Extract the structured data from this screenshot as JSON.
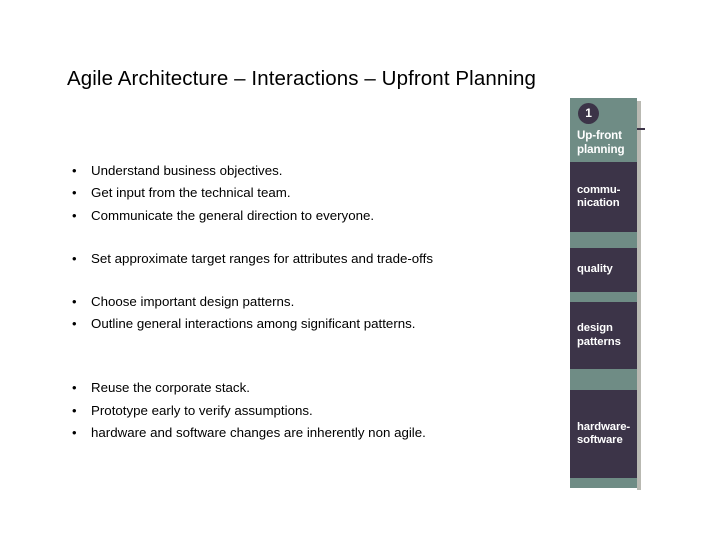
{
  "slide": {
    "title": "Agile Architecture – Interactions – Upfront Planning",
    "bullet_marker": "•",
    "groups": [
      {
        "items": [
          "Understand business objectives.",
          "Get input from the technical team.",
          "Communicate the general direction to everyone."
        ]
      },
      {
        "items": [
          "Set approximate target ranges for attributes and trade-offs"
        ]
      },
      {
        "items": [
          "Choose important design patterns.",
          "Outline general interactions among significant patterns."
        ]
      },
      {
        "items": [
          "Reuse the corporate stack.",
          "Prototype early to verify assumptions.",
          "hardware and software changes are inherently non agile."
        ]
      }
    ]
  },
  "diagram": {
    "step_number": "1",
    "blocks": [
      {
        "key": "upfront",
        "label": "Up-front\nplanning"
      },
      {
        "key": "communication",
        "label": "commu-\nnication"
      },
      {
        "key": "quality",
        "label": "quality"
      },
      {
        "key": "design",
        "label": "design\npatterns"
      },
      {
        "key": "hardware",
        "label": "hardware-\nsoftware"
      }
    ],
    "colors": {
      "accent_green": "#6f8c85",
      "accent_purple": "#3c3448",
      "label_text": "#ffffff",
      "shadow": "#b9b9b2"
    }
  }
}
